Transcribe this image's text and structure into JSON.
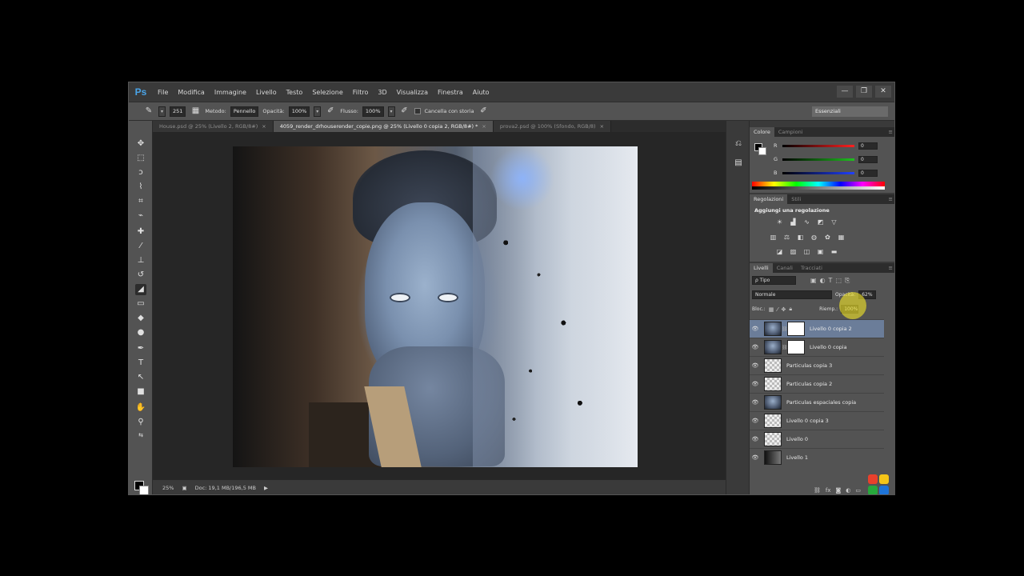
{
  "app": {
    "logo": "Ps",
    "menu": [
      "File",
      "Modifica",
      "Immagine",
      "Livello",
      "Testo",
      "Selezione",
      "Filtro",
      "3D",
      "Visualizza",
      "Finestra",
      "Aiuto"
    ],
    "window_controls": {
      "minimize": "—",
      "restore": "❐",
      "close": "✕"
    }
  },
  "options": {
    "brush_size": "251",
    "method_label": "Metodo:",
    "method_value": "Pennello",
    "opacity_label": "Opacità:",
    "opacity_value": "100%",
    "flow_label": "Flusso:",
    "flow_value": "100%",
    "history_label": "Cancella con storia",
    "workspace": "Essenziali"
  },
  "tabs": [
    {
      "label": "House.psd @ 25% (Livello 2, RGB/8#)",
      "active": false
    },
    {
      "label": "4059_render_drhouserender_copie.png @ 25% (Livello 0 copia 2, RGB/8#) *",
      "active": true
    },
    {
      "label": "prova2.psd @ 100% (Sfondo, RGB/8)",
      "active": false
    }
  ],
  "status": {
    "zoom": "25%",
    "doc": "Doc: 19,1 MB/196,5 MB"
  },
  "color_panel": {
    "tabs": [
      "Colore",
      "Campioni"
    ],
    "sliders": [
      {
        "label": "R",
        "value": "0",
        "color": "#ff2020"
      },
      {
        "label": "G",
        "value": "0",
        "color": "#20c020"
      },
      {
        "label": "B",
        "value": "0",
        "color": "#2040ff"
      }
    ]
  },
  "adjustments_panel": {
    "tabs": [
      "Regolazioni",
      "Stili"
    ],
    "title": "Aggiungi una regolazione"
  },
  "layers_panel": {
    "tabs": [
      "Livelli",
      "Canali",
      "Tracciati"
    ],
    "kind_filter": "ρ Tipo",
    "blend_mode": "Normale",
    "opacity_label": "Opacità:",
    "opacity_value": "62%",
    "lock_label": "Bloc.:",
    "fill_label": "Riemp.:",
    "fill_value": "100%",
    "layers": [
      {
        "name": "Livello 0 copia 2",
        "thumb": "photo",
        "mask": true,
        "selected": true
      },
      {
        "name": "Livello 0 copia",
        "thumb": "photo",
        "mask": true,
        "selected": false
      },
      {
        "name": "Particulas copia 3",
        "thumb": "transparent",
        "mask": false,
        "selected": false
      },
      {
        "name": "Particulas copia 2",
        "thumb": "transparent",
        "mask": false,
        "selected": false
      },
      {
        "name": "Particulas espaciales copia",
        "thumb": "photo",
        "mask": false,
        "selected": false
      },
      {
        "name": "Livello 0 copia 3",
        "thumb": "transparent",
        "mask": false,
        "selected": false
      },
      {
        "name": "Livello 0",
        "thumb": "transparent",
        "mask": false,
        "selected": false
      },
      {
        "name": "Livello 1",
        "thumb": "gradient",
        "mask": false,
        "selected": false
      }
    ]
  },
  "colors": {
    "accent": "#4aa4e8",
    "selection": "#6b7d99",
    "highlight": "#f0e428"
  }
}
